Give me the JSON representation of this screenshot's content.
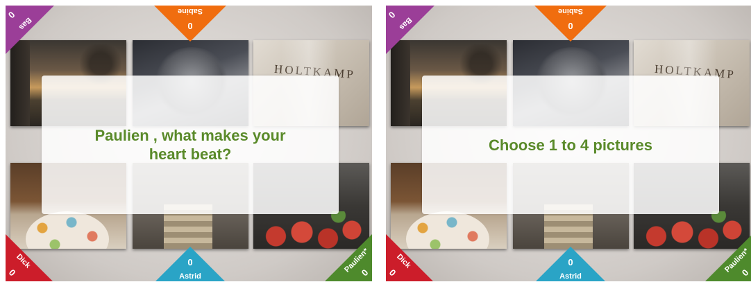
{
  "screens": [
    {
      "prompt": "Paulien , what makes your heart beat?",
      "tiles": [
        "sunset-photo",
        "dark-object-photo",
        "shopping-bag-photo",
        "cake-plate-photo",
        "room-photo",
        "strawberries-photo"
      ],
      "brand_text": "HOLTKAMP"
    },
    {
      "prompt": "Choose 1 to 4 pictures",
      "tiles": [
        "sunset-photo",
        "dark-object-photo",
        "shopping-bag-photo",
        "cake-plate-photo",
        "room-photo",
        "strawberries-photo"
      ],
      "brand_text": "HOLTKAMP"
    }
  ],
  "players": {
    "top": {
      "name": "Sabine",
      "score": "0",
      "color": "#f06d0f"
    },
    "top_left": {
      "name": "Bas",
      "score": "0",
      "color": "#9b3e98"
    },
    "bottom_left": {
      "name": "Dick",
      "score": "0",
      "color": "#cc1d2a"
    },
    "bottom": {
      "name": "Astrid",
      "score": "0",
      "color": "#2aa4c6"
    },
    "bottom_right": {
      "name": "Paulien*",
      "score": "0",
      "color": "#4e8a2c"
    }
  },
  "prompt_color": "#5a8a2a"
}
